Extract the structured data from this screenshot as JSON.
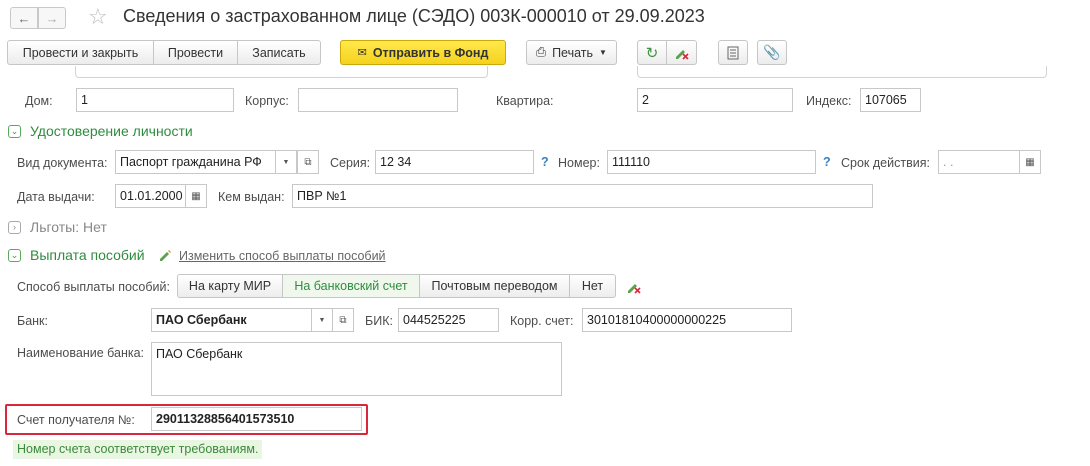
{
  "header": {
    "title": "Сведения о застрахованном лице (СЭДО) 003К-000010 от 29.09.2023"
  },
  "toolbar": {
    "post_close": "Провести и закрыть",
    "post": "Провести",
    "save": "Записать",
    "send": "Отправить в Фонд",
    "print": "Печать"
  },
  "address": {
    "house_label": "Дом:",
    "house_value": "1",
    "building_label": "Корпус:",
    "building_value": "",
    "apartment_label": "Квартира:",
    "apartment_value": "2",
    "index_label": "Индекс:",
    "index_value": "107065"
  },
  "identity": {
    "section_title": "Удостоверение личности",
    "doc_type_label": "Вид документа:",
    "doc_type_value": "Паспорт гражданина РФ",
    "series_label": "Серия:",
    "series_value": "12 34",
    "number_label": "Номер:",
    "number_value": "111110",
    "validity_label": "Срок действия:",
    "validity_value": " .  .",
    "issue_date_label": "Дата выдачи:",
    "issue_date_value": "01.01.2000",
    "issued_by_label": "Кем выдан:",
    "issued_by_value": "ПВР №1"
  },
  "benefits": {
    "section_title": "Льготы: Нет"
  },
  "payment": {
    "section_title": "Выплата пособий",
    "change_link": "Изменить способ выплаты пособий",
    "method_label": "Способ выплаты пособий:",
    "methods": [
      "На карту МИР",
      "На банковский счет",
      "Почтовым переводом",
      "Нет"
    ],
    "active_method": "На банковский счет",
    "bank_label": "Банк:",
    "bank_value": "ПАО Сбербанк",
    "bik_label": "БИК:",
    "bik_value": "044525225",
    "corr_label": "Корр. счет:",
    "corr_value": "30101810400000000225",
    "bank_name_label": "Наименование банка:",
    "bank_name_value": "ПАО Сбербанк",
    "account_label": "Счет получателя №:",
    "account_value": "29011328856401573510",
    "status_text": "Номер счета соответствует требованиям."
  },
  "colors": {
    "accent_green": "#2f8c3f",
    "primary_yellow": "#f5d21e",
    "highlight_red": "#d9283b"
  }
}
